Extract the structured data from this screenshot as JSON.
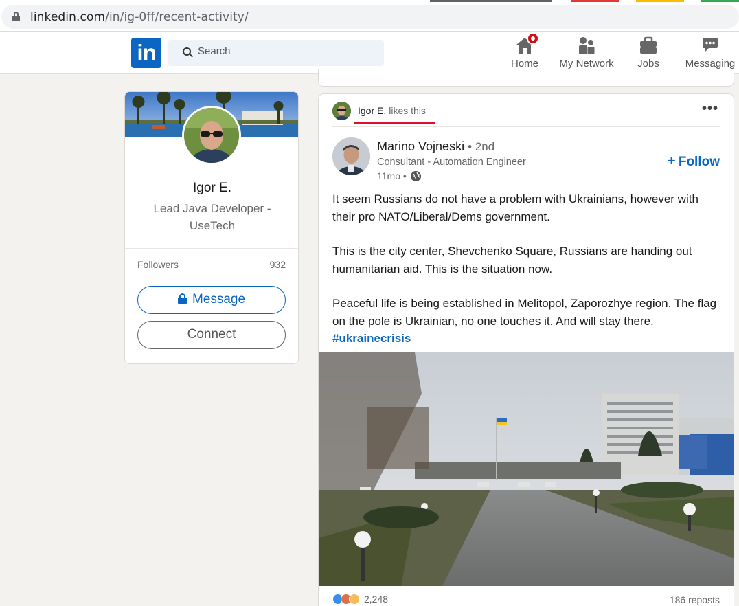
{
  "browser": {
    "url_host": "linkedin.com",
    "url_path": "/in/ig-0ff/recent-activity/"
  },
  "nav": {
    "logo": "in",
    "search_placeholder": "Search",
    "items": [
      {
        "label": "Home",
        "icon": "home-icon"
      },
      {
        "label": "My Network",
        "icon": "my-network-icon"
      },
      {
        "label": "Jobs",
        "icon": "jobs-icon"
      },
      {
        "label": "Messaging",
        "icon": "messaging-icon"
      }
    ]
  },
  "profile": {
    "name": "Igor E.",
    "title": "Lead Java Developer - UseTech",
    "followers_label": "Followers",
    "followers_count": "932",
    "message_label": "Message",
    "connect_label": "Connect"
  },
  "post": {
    "actor_name": "Igor E.",
    "actor_action": "likes this",
    "author_name": "Marino Vojneski",
    "author_degree": "• 2nd",
    "author_headline": "Consultant - Automation Engineer",
    "time": "11mo •",
    "follow_label": "Follow",
    "paragraphs": [
      "It seem Russians do not have a problem with Ukrainians, however with their pro NATO/Liberal/Dems government.",
      "This is the city center, Shevchenko Square, Russians are handing out humanitarian aid. This is the situation now.",
      "Peaceful life is being established in Melitopol, Zaporozhye region. The flag on the pole is Ukrainian, no one touches it. And will stay there."
    ],
    "hashtag": "#ukrainecrisis",
    "reaction_count": "2,248",
    "reposts": "186 reposts"
  },
  "colors": {
    "brand": "#0a66c2",
    "badge": "#cc1016",
    "annotation_underline": "#e0102a"
  }
}
